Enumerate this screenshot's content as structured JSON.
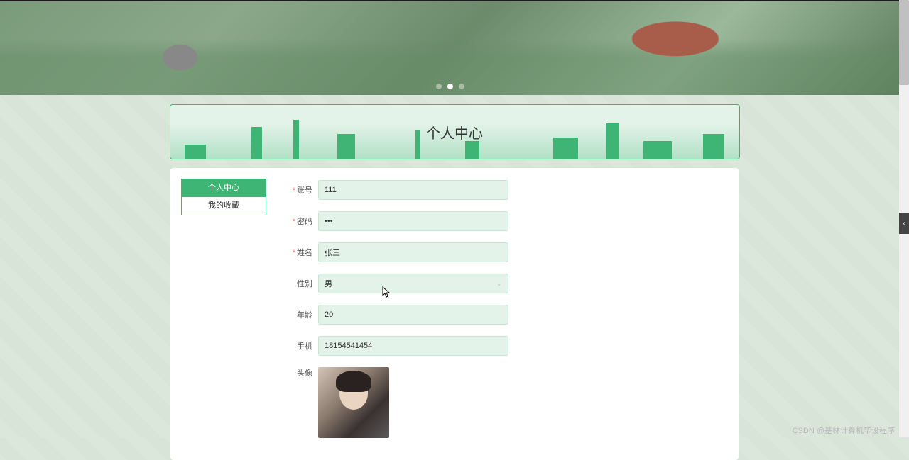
{
  "hero": {
    "dots_count": 3,
    "active_dot": 1
  },
  "page_title": "个人中心",
  "sidebar": {
    "items": [
      {
        "label": "个人中心",
        "active": true
      },
      {
        "label": "我的收藏",
        "active": false
      }
    ]
  },
  "form": {
    "account": {
      "label": "账号",
      "value": "111",
      "required": true
    },
    "password": {
      "label": "密码",
      "value": "111",
      "required": true
    },
    "name": {
      "label": "姓名",
      "value": "张三",
      "required": true
    },
    "gender": {
      "label": "性别",
      "value": "男",
      "required": false
    },
    "age": {
      "label": "年龄",
      "value": "20",
      "required": false
    },
    "phone": {
      "label": "手机",
      "value": "18154541454",
      "required": false
    },
    "avatar": {
      "label": "头像",
      "required": false
    }
  },
  "watermark": "CSDN @基林计算机毕设程序",
  "side_tab_icon": "‹"
}
